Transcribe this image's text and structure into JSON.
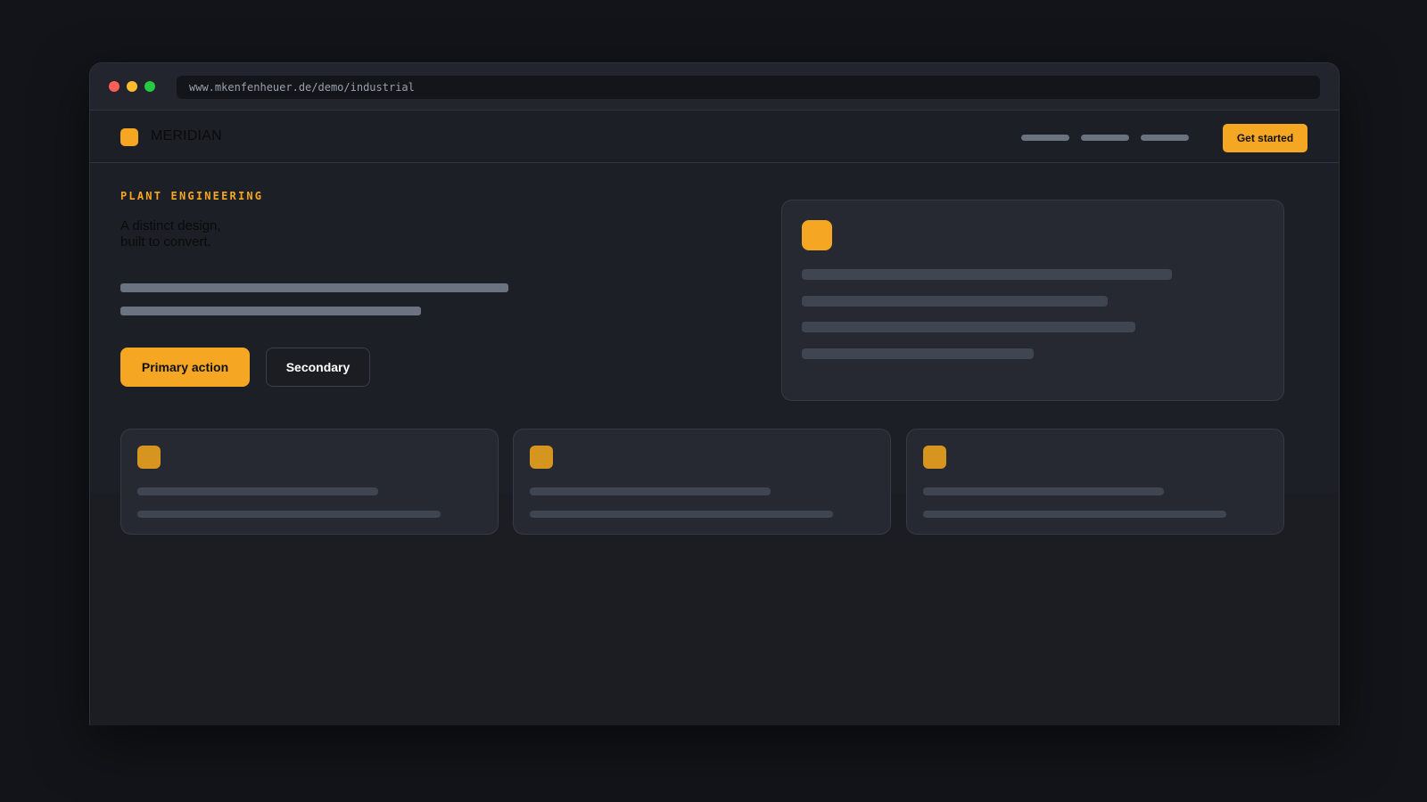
{
  "browser": {
    "url": "www.mkenfenheuer.de/demo/industrial"
  },
  "brand": {
    "name": "MERIDIAN",
    "accent_color": "#f5a623",
    "accent_muted_color": "#d6951f"
  },
  "nav": {
    "cta_label": "Get started"
  },
  "hero": {
    "eyebrow": "PLANT ENGINEERING",
    "headline_line1": "A distinct design,",
    "headline_line2": "built to convert.",
    "primary_label": "Primary action",
    "secondary_label": "Secondary"
  }
}
